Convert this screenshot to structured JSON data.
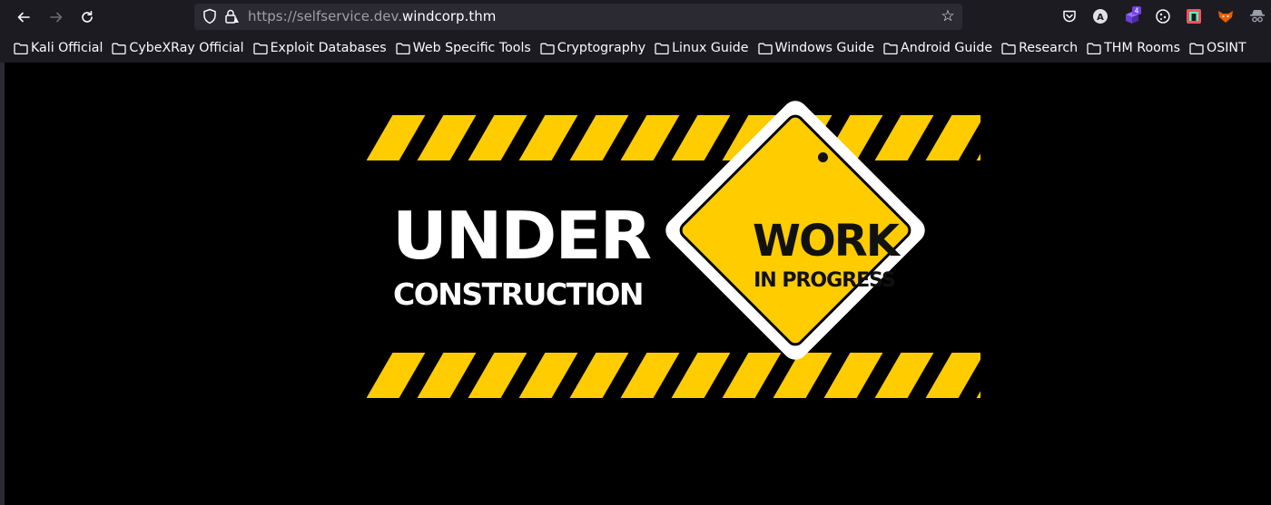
{
  "toolbar": {
    "back_icon": "arrow-left-icon",
    "forward_icon": "arrow-right-icon",
    "reload_icon": "reload-icon"
  },
  "urlbar": {
    "url_prefix": "https://selfservice.dev.",
    "url_domain": "windcorp.thm"
  },
  "extensions": {
    "badge_count": "4",
    "colors": {
      "pocket": "#fbfbfe",
      "ext_purple": "#7542e5",
      "ext_multicolor": "#ff4f5e",
      "ext_fox": "#e66000"
    }
  },
  "bookmarks": [
    "Kali Official",
    "CybeXRay Official",
    "Exploit Databases",
    "Web Specific Tools",
    "Cryptography",
    "Linux Guide",
    "Windows Guide",
    "Android Guide",
    "Research",
    "THM Rooms",
    "OSINT"
  ],
  "page": {
    "under": "UNDER",
    "construction": "CONSTRUCTION",
    "work": "WORK",
    "in_progress": "IN PROGRESS",
    "accent": "#ffcc00"
  }
}
